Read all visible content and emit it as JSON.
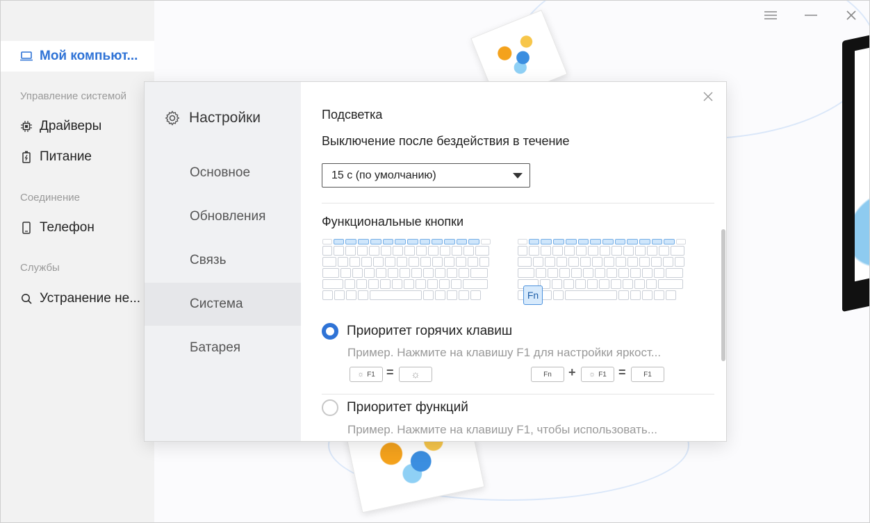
{
  "window": {
    "menu_icon": "menu-icon",
    "minimize_icon": "minimize-icon",
    "close_icon": "close-icon"
  },
  "sidebar": {
    "my_computer": "Мой компьют...",
    "section_system": "Управление системой",
    "drivers": "Драйверы",
    "power": "Питание",
    "section_connection": "Соединение",
    "phone": "Телефон",
    "section_services": "Службы",
    "troubleshoot": "Устранение не..."
  },
  "dialog": {
    "title": "Настройки",
    "nav": [
      "Основное",
      "Обновления",
      "Связь",
      "Система",
      "Батарея"
    ],
    "active_nav": "Система",
    "backlight": {
      "heading": "Подсветка",
      "description": "Выключение после бездействия в течение",
      "select_value": "15 с (по умолчанию)"
    },
    "function_keys": {
      "heading": "Функциональные кнопки",
      "fn_label": "Fn",
      "hotkey": {
        "label": "Приоритет горячих клавиш",
        "example": "Пример. Нажмите на клавишу F1 для настройки яркост...",
        "selected": true
      },
      "function": {
        "label": "Приоритет функций",
        "example": "Пример. Нажмите на клавишу F1, чтобы использовать...",
        "selected": false
      },
      "keycaps": {
        "f1": "F1",
        "fn": "Fn",
        "plus": "+",
        "equals": "="
      }
    }
  },
  "colors": {
    "accent": "#2f73d6",
    "sidebar_bg": "#f2f2f2",
    "dialog_nav_bg": "#f0f1f3"
  }
}
